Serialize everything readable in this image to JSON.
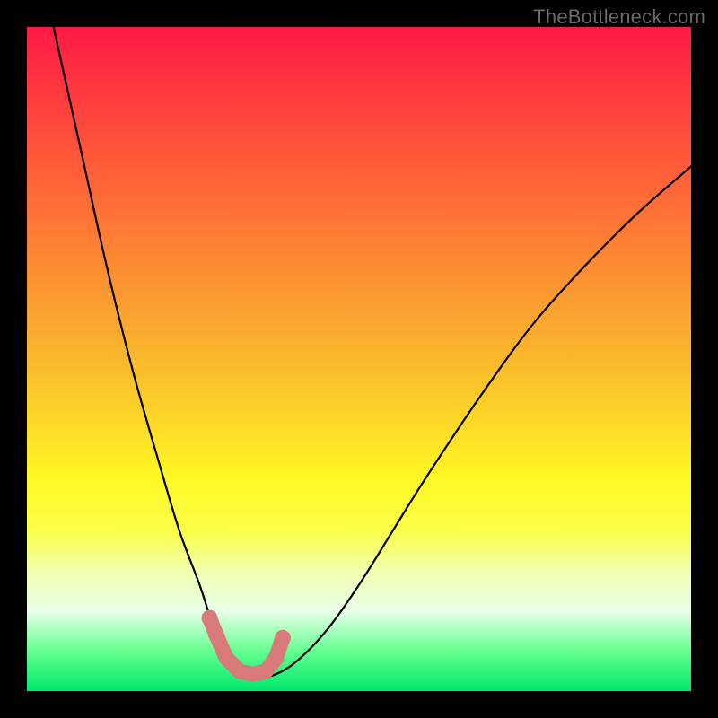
{
  "watermark": "TheBottleneck.com",
  "chart_data": {
    "type": "line",
    "title": "",
    "xlabel": "",
    "ylabel": "",
    "xlim": [
      0,
      100
    ],
    "ylim": [
      0,
      100
    ],
    "grid": false,
    "series": [
      {
        "name": "bottleneck-curve",
        "x": [
          4,
          8,
          12,
          16,
          20,
          23,
          26,
          28,
          30,
          32,
          34,
          36,
          40,
          45,
          50,
          55,
          60,
          68,
          76,
          84,
          92,
          100
        ],
        "y": [
          100,
          82,
          64,
          48,
          34,
          24,
          16,
          10,
          6,
          3,
          2,
          2,
          4,
          9,
          16,
          24,
          32,
          44,
          55,
          64,
          72,
          79
        ]
      }
    ],
    "highlight": {
      "name": "optimal-zone",
      "points": [
        {
          "x": 27.5,
          "y": 11
        },
        {
          "x": 28.5,
          "y": 8.5
        },
        {
          "x": 30,
          "y": 5
        },
        {
          "x": 32,
          "y": 3
        },
        {
          "x": 34,
          "y": 2.5
        },
        {
          "x": 36,
          "y": 3
        },
        {
          "x": 37.5,
          "y": 5
        },
        {
          "x": 38.5,
          "y": 8
        }
      ]
    },
    "background_gradient": {
      "top": "#ff1946",
      "mid": "#fdda28",
      "bottom": "#00e86b"
    }
  }
}
